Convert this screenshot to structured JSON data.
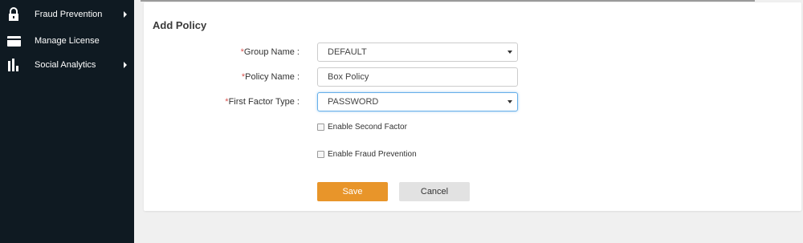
{
  "sidebar": {
    "items": [
      {
        "label": "Fraud Prevention",
        "icon": "lock-icon",
        "has_submenu": true
      },
      {
        "label": "Manage License",
        "icon": "credit-card-icon",
        "has_submenu": false
      },
      {
        "label": "Social Analytics",
        "icon": "bar-chart-icon",
        "has_submenu": true
      }
    ]
  },
  "form": {
    "title": "Add Policy",
    "required_marker": "*",
    "group_name": {
      "label": "Group Name :",
      "value": "DEFAULT"
    },
    "policy_name": {
      "label": "Policy Name :",
      "value": "Box Policy"
    },
    "first_factor_type": {
      "label": "First Factor Type :",
      "value": "PASSWORD"
    },
    "enable_second_factor": {
      "label": "Enable Second Factor",
      "checked": false
    },
    "enable_fraud_prevention": {
      "label": "Enable Fraud Prevention",
      "checked": false
    },
    "save_label": "Save",
    "cancel_label": "Cancel"
  },
  "colors": {
    "sidebar_bg": "#0f1a22",
    "save_button": "#e8952a",
    "required": "#d9534f"
  }
}
